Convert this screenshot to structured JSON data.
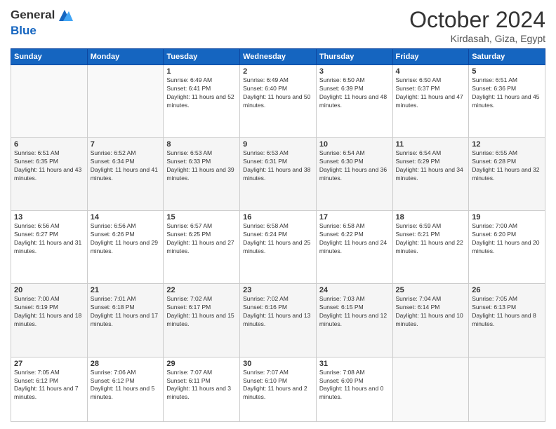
{
  "header": {
    "logo_line1": "General",
    "logo_line2": "Blue",
    "month": "October 2024",
    "location": "Kirdasah, Giza, Egypt"
  },
  "weekdays": [
    "Sunday",
    "Monday",
    "Tuesday",
    "Wednesday",
    "Thursday",
    "Friday",
    "Saturday"
  ],
  "weeks": [
    [
      {
        "day": null
      },
      {
        "day": null
      },
      {
        "day": "1",
        "sunrise": "Sunrise: 6:49 AM",
        "sunset": "Sunset: 6:41 PM",
        "daylight": "Daylight: 11 hours and 52 minutes."
      },
      {
        "day": "2",
        "sunrise": "Sunrise: 6:49 AM",
        "sunset": "Sunset: 6:40 PM",
        "daylight": "Daylight: 11 hours and 50 minutes."
      },
      {
        "day": "3",
        "sunrise": "Sunrise: 6:50 AM",
        "sunset": "Sunset: 6:39 PM",
        "daylight": "Daylight: 11 hours and 48 minutes."
      },
      {
        "day": "4",
        "sunrise": "Sunrise: 6:50 AM",
        "sunset": "Sunset: 6:37 PM",
        "daylight": "Daylight: 11 hours and 47 minutes."
      },
      {
        "day": "5",
        "sunrise": "Sunrise: 6:51 AM",
        "sunset": "Sunset: 6:36 PM",
        "daylight": "Daylight: 11 hours and 45 minutes."
      }
    ],
    [
      {
        "day": "6",
        "sunrise": "Sunrise: 6:51 AM",
        "sunset": "Sunset: 6:35 PM",
        "daylight": "Daylight: 11 hours and 43 minutes."
      },
      {
        "day": "7",
        "sunrise": "Sunrise: 6:52 AM",
        "sunset": "Sunset: 6:34 PM",
        "daylight": "Daylight: 11 hours and 41 minutes."
      },
      {
        "day": "8",
        "sunrise": "Sunrise: 6:53 AM",
        "sunset": "Sunset: 6:33 PM",
        "daylight": "Daylight: 11 hours and 39 minutes."
      },
      {
        "day": "9",
        "sunrise": "Sunrise: 6:53 AM",
        "sunset": "Sunset: 6:31 PM",
        "daylight": "Daylight: 11 hours and 38 minutes."
      },
      {
        "day": "10",
        "sunrise": "Sunrise: 6:54 AM",
        "sunset": "Sunset: 6:30 PM",
        "daylight": "Daylight: 11 hours and 36 minutes."
      },
      {
        "day": "11",
        "sunrise": "Sunrise: 6:54 AM",
        "sunset": "Sunset: 6:29 PM",
        "daylight": "Daylight: 11 hours and 34 minutes."
      },
      {
        "day": "12",
        "sunrise": "Sunrise: 6:55 AM",
        "sunset": "Sunset: 6:28 PM",
        "daylight": "Daylight: 11 hours and 32 minutes."
      }
    ],
    [
      {
        "day": "13",
        "sunrise": "Sunrise: 6:56 AM",
        "sunset": "Sunset: 6:27 PM",
        "daylight": "Daylight: 11 hours and 31 minutes."
      },
      {
        "day": "14",
        "sunrise": "Sunrise: 6:56 AM",
        "sunset": "Sunset: 6:26 PM",
        "daylight": "Daylight: 11 hours and 29 minutes."
      },
      {
        "day": "15",
        "sunrise": "Sunrise: 6:57 AM",
        "sunset": "Sunset: 6:25 PM",
        "daylight": "Daylight: 11 hours and 27 minutes."
      },
      {
        "day": "16",
        "sunrise": "Sunrise: 6:58 AM",
        "sunset": "Sunset: 6:24 PM",
        "daylight": "Daylight: 11 hours and 25 minutes."
      },
      {
        "day": "17",
        "sunrise": "Sunrise: 6:58 AM",
        "sunset": "Sunset: 6:22 PM",
        "daylight": "Daylight: 11 hours and 24 minutes."
      },
      {
        "day": "18",
        "sunrise": "Sunrise: 6:59 AM",
        "sunset": "Sunset: 6:21 PM",
        "daylight": "Daylight: 11 hours and 22 minutes."
      },
      {
        "day": "19",
        "sunrise": "Sunrise: 7:00 AM",
        "sunset": "Sunset: 6:20 PM",
        "daylight": "Daylight: 11 hours and 20 minutes."
      }
    ],
    [
      {
        "day": "20",
        "sunrise": "Sunrise: 7:00 AM",
        "sunset": "Sunset: 6:19 PM",
        "daylight": "Daylight: 11 hours and 18 minutes."
      },
      {
        "day": "21",
        "sunrise": "Sunrise: 7:01 AM",
        "sunset": "Sunset: 6:18 PM",
        "daylight": "Daylight: 11 hours and 17 minutes."
      },
      {
        "day": "22",
        "sunrise": "Sunrise: 7:02 AM",
        "sunset": "Sunset: 6:17 PM",
        "daylight": "Daylight: 11 hours and 15 minutes."
      },
      {
        "day": "23",
        "sunrise": "Sunrise: 7:02 AM",
        "sunset": "Sunset: 6:16 PM",
        "daylight": "Daylight: 11 hours and 13 minutes."
      },
      {
        "day": "24",
        "sunrise": "Sunrise: 7:03 AM",
        "sunset": "Sunset: 6:15 PM",
        "daylight": "Daylight: 11 hours and 12 minutes."
      },
      {
        "day": "25",
        "sunrise": "Sunrise: 7:04 AM",
        "sunset": "Sunset: 6:14 PM",
        "daylight": "Daylight: 11 hours and 10 minutes."
      },
      {
        "day": "26",
        "sunrise": "Sunrise: 7:05 AM",
        "sunset": "Sunset: 6:13 PM",
        "daylight": "Daylight: 11 hours and 8 minutes."
      }
    ],
    [
      {
        "day": "27",
        "sunrise": "Sunrise: 7:05 AM",
        "sunset": "Sunset: 6:12 PM",
        "daylight": "Daylight: 11 hours and 7 minutes."
      },
      {
        "day": "28",
        "sunrise": "Sunrise: 7:06 AM",
        "sunset": "Sunset: 6:12 PM",
        "daylight": "Daylight: 11 hours and 5 minutes."
      },
      {
        "day": "29",
        "sunrise": "Sunrise: 7:07 AM",
        "sunset": "Sunset: 6:11 PM",
        "daylight": "Daylight: 11 hours and 3 minutes."
      },
      {
        "day": "30",
        "sunrise": "Sunrise: 7:07 AM",
        "sunset": "Sunset: 6:10 PM",
        "daylight": "Daylight: 11 hours and 2 minutes."
      },
      {
        "day": "31",
        "sunrise": "Sunrise: 7:08 AM",
        "sunset": "Sunset: 6:09 PM",
        "daylight": "Daylight: 11 hours and 0 minutes."
      },
      {
        "day": null
      },
      {
        "day": null
      }
    ]
  ]
}
